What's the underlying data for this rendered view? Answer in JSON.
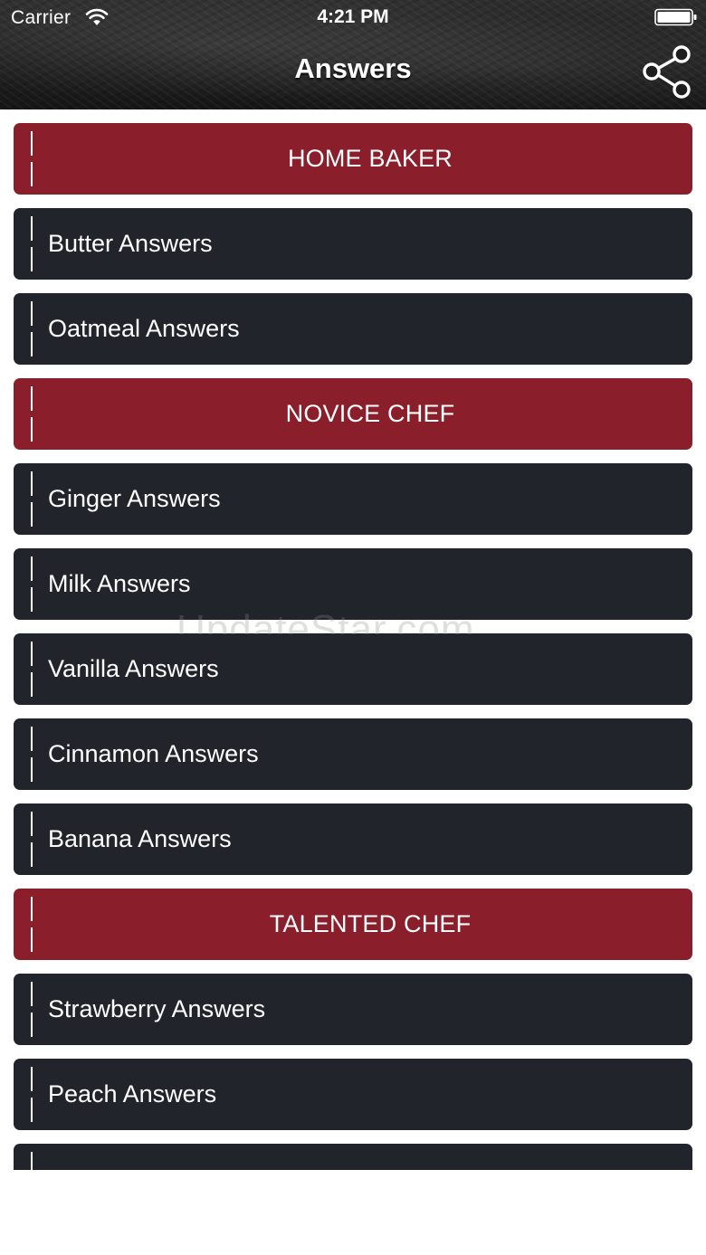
{
  "status_bar": {
    "carrier": "Carrier",
    "time": "4:21 PM"
  },
  "nav": {
    "title": "Answers",
    "share_icon": "share-icon"
  },
  "colors": {
    "section": "#8a1f2b",
    "item": "#21252b",
    "text": "#ffffff"
  },
  "rows": [
    {
      "type": "section",
      "label": "HOME BAKER"
    },
    {
      "type": "item",
      "label": "Butter Answers"
    },
    {
      "type": "item",
      "label": "Oatmeal Answers"
    },
    {
      "type": "section",
      "label": "NOVICE CHEF"
    },
    {
      "type": "item",
      "label": "Ginger Answers"
    },
    {
      "type": "item",
      "label": "Milk Answers"
    },
    {
      "type": "item",
      "label": "Vanilla Answers"
    },
    {
      "type": "item",
      "label": "Cinnamon Answers"
    },
    {
      "type": "item",
      "label": "Banana Answers"
    },
    {
      "type": "section",
      "label": "TALENTED CHEF"
    },
    {
      "type": "item",
      "label": "Strawberry Answers"
    },
    {
      "type": "item",
      "label": "Peach Answers"
    },
    {
      "type": "item",
      "label": ""
    }
  ],
  "watermark": "UpdateStar.com"
}
